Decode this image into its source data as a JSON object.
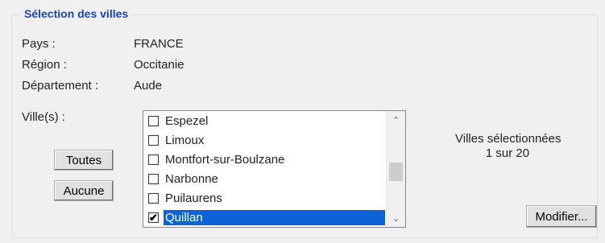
{
  "group": {
    "title": "Sélection des villes"
  },
  "info": {
    "pays_label": "Pays :",
    "pays_value": "FRANCE",
    "region_label": "Région :",
    "region_value": "Occitanie",
    "departement_label": "Département :",
    "departement_value": "Aude"
  },
  "villes": {
    "label": "Ville(s) :",
    "items": [
      {
        "label": "Espezel",
        "checked": false,
        "selected": false
      },
      {
        "label": "Limoux",
        "checked": false,
        "selected": false
      },
      {
        "label": "Montfort-sur-Boulzane",
        "checked": false,
        "selected": false
      },
      {
        "label": "Narbonne",
        "checked": false,
        "selected": false
      },
      {
        "label": "Puilaurens",
        "checked": false,
        "selected": false
      },
      {
        "label": "Quillan",
        "checked": true,
        "selected": true
      }
    ]
  },
  "buttons": {
    "all_label": "Toutes",
    "none_label": "Aucune",
    "modify_label": "Modifier..."
  },
  "summary": {
    "line1": "Villes sélectionnées",
    "line2": "1 sur 20"
  },
  "icons": {
    "check": "✔",
    "scroll_up": "⌃",
    "scroll_down": "⌄"
  },
  "colors": {
    "title": "#1a44b8",
    "selection": "#0a64d8"
  }
}
